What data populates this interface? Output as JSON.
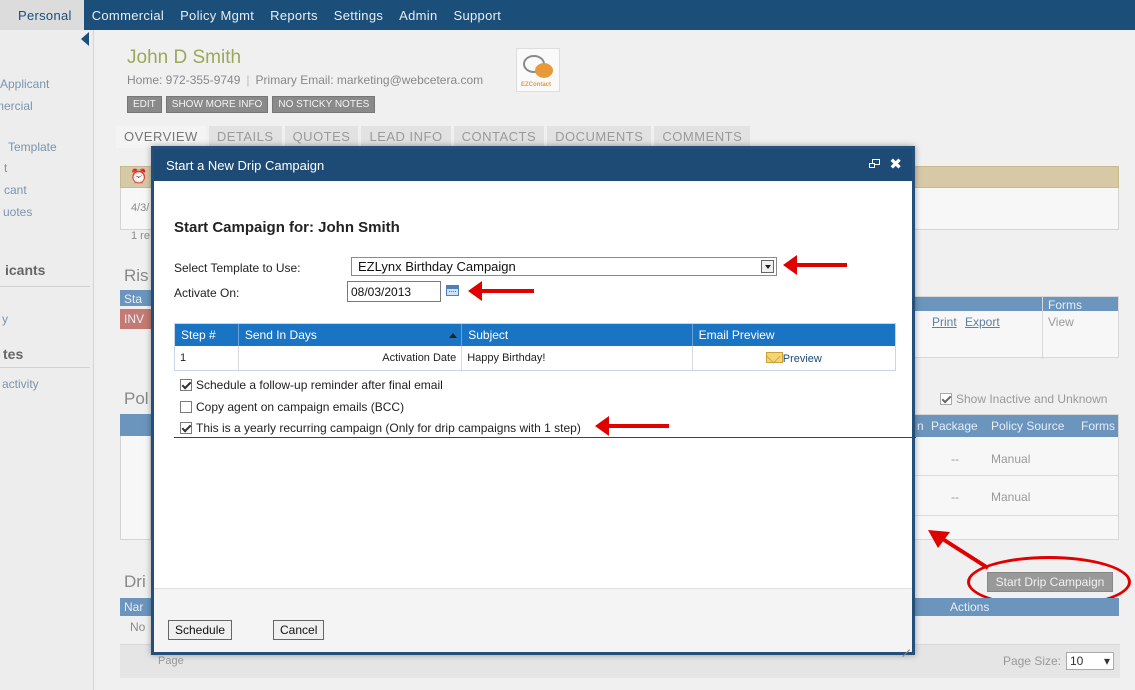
{
  "topnav": {
    "tabs": [
      "Personal",
      "Commercial",
      "Policy Mgmt",
      "Reports",
      "Settings",
      "Admin",
      "Support"
    ],
    "active": "Personal"
  },
  "sidebar": {
    "items": [
      "Applicant",
      "mercial",
      "Template",
      "t",
      "cant",
      "uotes",
      "y",
      "activity"
    ],
    "headings": [
      "icants",
      "tes"
    ]
  },
  "contact": {
    "name": "John D Smith",
    "home_label": "Home: 972-355-9749",
    "email_label": "Primary Email: marketing@webcetera.com",
    "buttons": [
      "EDIT",
      "SHOW MORE INFO",
      "NO STICKY NOTES"
    ],
    "logo_text": "EZContact"
  },
  "profile_tabs": [
    "OVERVIEW",
    "DETAILS",
    "QUOTES",
    "LEAD INFO",
    "CONTACTS",
    "DOCUMENTS",
    "COMMENTS"
  ],
  "background": {
    "date_snippet": "4/3/",
    "reminder_snippet": "1 re",
    "risk_heading": "Ris",
    "status_snippet": "Sta",
    "inv_snippet": "INV",
    "policy_heading": "Pol",
    "drip_heading": "Dri",
    "name_snippet": "Nar",
    "no_snippet": "No",
    "forms_header": "Forms",
    "print": "Print",
    "export": "Export",
    "view": "View",
    "show_inactive": "Show Inactive and Unknown",
    "policy_headers": [
      "n",
      "Package",
      "Policy Source",
      "Forms"
    ],
    "policy_rows": [
      {
        "package": "--",
        "source": "Manual"
      },
      {
        "package": "--",
        "source": "Manual"
      }
    ],
    "start_drip_button": "Start Drip Campaign",
    "actions_header": "Actions",
    "page_label": "Page",
    "page_size_label": "Page Size:",
    "page_size_value": "10"
  },
  "modal": {
    "title": "Start a New Drip Campaign",
    "heading": "Start Campaign for: John Smith",
    "template_label": "Select Template to Use:",
    "template_value": "EZLynx Birthday Campaign",
    "activate_label": "Activate On:",
    "activate_value": "08/03/2013",
    "table": {
      "headers": [
        "Step #",
        "Send In Days",
        "Subject",
        "Email Preview"
      ],
      "rows": [
        {
          "step": "1",
          "send_in_days": "Activation Date",
          "subject": "Happy Birthday!",
          "preview": "Preview"
        }
      ]
    },
    "options": [
      {
        "label": "Schedule a follow-up reminder after final email",
        "checked": true
      },
      {
        "label": "Copy agent on campaign emails (BCC)",
        "checked": false
      },
      {
        "label": "This is a yearly recurring campaign (Only for drip campaigns with 1 step)",
        "checked": true
      }
    ],
    "schedule_button": "Schedule",
    "cancel_button": "Cancel"
  },
  "colors": {
    "nav_bg": "#1b4e79",
    "modal_title_bg": "#1d4b76",
    "table_header_bg": "#1a74c4",
    "annotation_red": "#e00000"
  }
}
